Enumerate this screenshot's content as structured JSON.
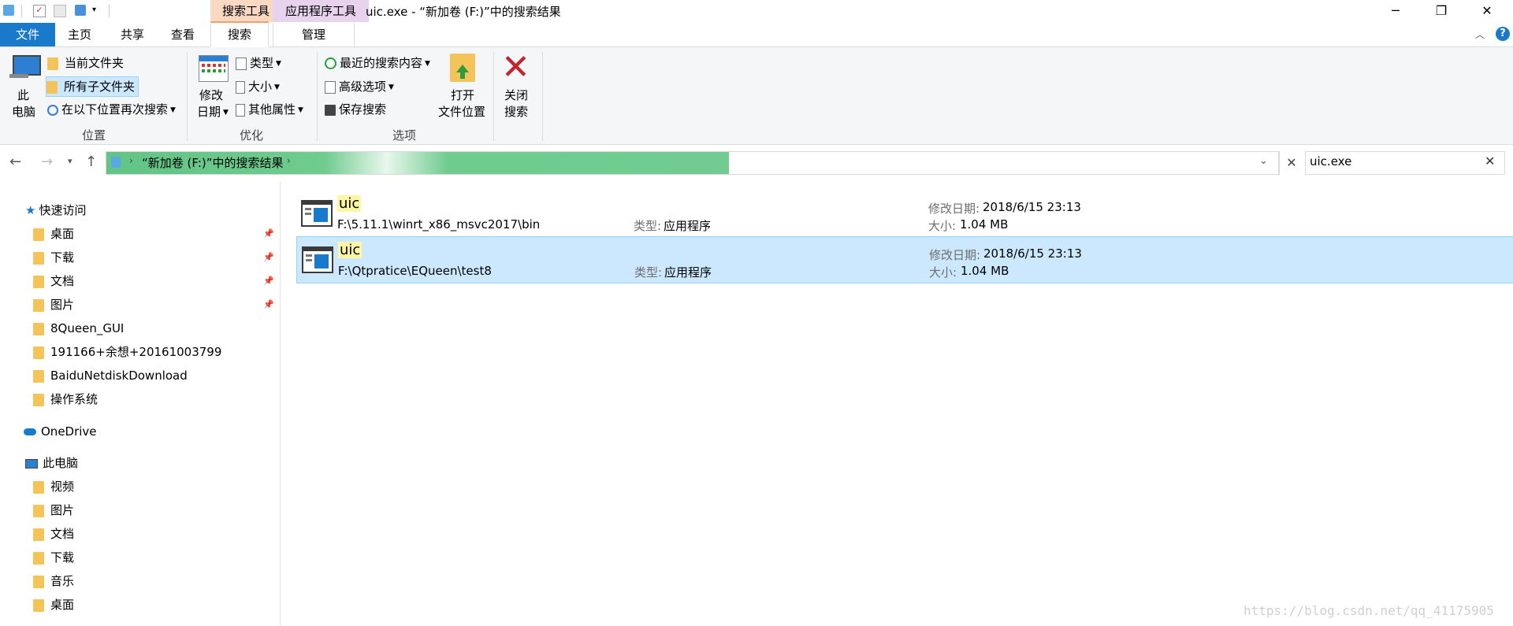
{
  "window": {
    "title": "uic.exe - “新加卷 (F:)”中的搜索结果",
    "context_tab_search_tools": "搜索工具",
    "context_tab_app_tools": "应用程序工具",
    "minimize": "─",
    "maximize": "❐",
    "close": "✕"
  },
  "ribbon_tabs": {
    "file": "文件",
    "home": "主页",
    "share": "共享",
    "view": "查看",
    "search": "搜索",
    "manage": "管理"
  },
  "ribbon": {
    "location": {
      "this_pc_line1": "此",
      "this_pc_line2": "电脑",
      "current_folder": "当前文件夹",
      "all_subfolders": "所有子文件夹",
      "search_again": "在以下位置再次搜索",
      "label": "位置"
    },
    "refine": {
      "modified_line1": "修改",
      "modified_line2": "日期",
      "kind": "类型",
      "size": "大小",
      "other_props": "其他属性",
      "label": "优化"
    },
    "options": {
      "recent": "最近的搜索内容",
      "advanced": "高级选项",
      "save": "保存搜索",
      "open_line1": "打开",
      "open_line2": "文件位置",
      "label": "选项"
    },
    "close": {
      "line1": "关闭",
      "line2": "搜索"
    }
  },
  "address": {
    "path": "“新加卷 (F:)”中的搜索结果",
    "search_value": "uic.exe"
  },
  "nav": {
    "quick_access": "快速访问",
    "quick_items": [
      {
        "label": "桌面",
        "pinned": true
      },
      {
        "label": "下载",
        "pinned": true
      },
      {
        "label": "文档",
        "pinned": true
      },
      {
        "label": "图片",
        "pinned": true
      },
      {
        "label": "8Queen_GUI",
        "pinned": false
      },
      {
        "label": "191166+余想+20161003799",
        "pinned": false
      },
      {
        "label": "BaiduNetdiskDownload",
        "pinned": false
      },
      {
        "label": "操作系统",
        "pinned": false
      }
    ],
    "onedrive": "OneDrive",
    "this_pc": "此电脑",
    "pc_items": [
      "视频",
      "图片",
      "文档",
      "下载",
      "音乐",
      "桌面"
    ]
  },
  "results": [
    {
      "name": "uic",
      "path": "F:\\5.11.1\\winrt_x86_msvc2017\\bin",
      "type_label": "类型:",
      "type_value": "应用程序",
      "modified_label": "修改日期:",
      "modified_value": "2018/6/15 23:13",
      "size_label": "大小:",
      "size_value": "1.04 MB",
      "selected": false
    },
    {
      "name": "uic",
      "path": "F:\\Qtpratice\\EQueen\\test8",
      "type_label": "类型:",
      "type_value": "应用程序",
      "modified_label": "修改日期:",
      "modified_value": "2018/6/15 23:13",
      "size_label": "大小:",
      "size_value": "1.04 MB",
      "selected": true
    }
  ],
  "watermark": "https://blog.csdn.net/qq_41175905",
  "colors": {
    "file_tab": "#1979ca",
    "selection": "#cce8ff",
    "search_ctx": "#f9d9c4",
    "app_ctx": "#e8d3ee",
    "progress": "#6fcb8e"
  }
}
